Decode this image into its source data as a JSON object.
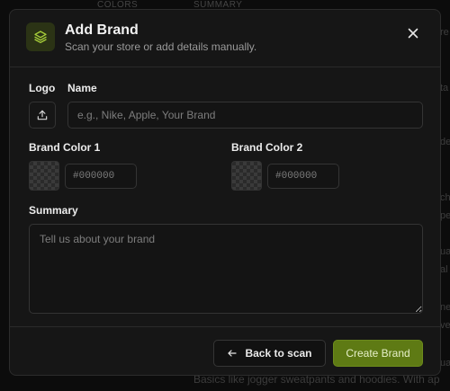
{
  "background": {
    "top_labels": [
      "COLORS",
      "SUMMARY"
    ],
    "right_fragments": [
      "re",
      "ta",
      "de",
      "ch",
      "pe",
      "ual",
      "al",
      "ne",
      "ve",
      "ua"
    ],
    "bottom_text": "Basics like jogger sweatpants and hoodies. With ap"
  },
  "modal": {
    "brand_icon": "layers-icon",
    "title": "Add Brand",
    "subtitle": "Scan your store or add details manually.",
    "close_icon": "close-icon"
  },
  "form": {
    "logo_label": "Logo",
    "upload_icon": "upload-icon",
    "name_label": "Name",
    "name_value": "",
    "name_placeholder": "e.g., Nike, Apple, Your Brand",
    "color1_label": "Brand Color 1",
    "color1_placeholder": "#000000",
    "color1_value": "",
    "color2_label": "Brand Color 2",
    "color2_placeholder": "#000000",
    "color2_value": "",
    "summary_label": "Summary",
    "summary_placeholder": "Tell us about your brand",
    "summary_value": ""
  },
  "footer": {
    "back_icon": "arrow-left-icon",
    "back_label": "Back to scan",
    "create_label": "Create Brand"
  },
  "colors": {
    "accent": "#5e7a14",
    "accent_icon": "#a9d13a",
    "surface": "#161616",
    "backdrop": "#0c0c0c"
  }
}
